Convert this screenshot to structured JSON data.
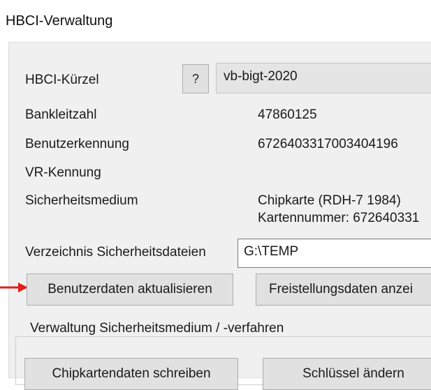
{
  "window": {
    "title": "HBCI-Verwaltung"
  },
  "hbci": {
    "kuerzel_label": "HBCI-Kürzel",
    "help_label": "?",
    "kuerzel_value": "vb-bigt-2020"
  },
  "details": {
    "blz_label": "Bankleitzahl",
    "blz_value": "47860125",
    "benutzer_label": "Benutzerkennung",
    "benutzer_value": "6726403317003404196",
    "vr_label": "VR-Kennung",
    "medium_label": "Sicherheitsmedium",
    "medium_value_line1": "Chipkarte  (RDH-7  1984)",
    "medium_value_line2": "Kartennummer: 672640331"
  },
  "directory": {
    "label": "Verzeichnis Sicherheitsdateien",
    "value": "G:\\TEMP"
  },
  "buttons": {
    "update_user": "Benutzerdaten aktualisieren",
    "show_free": "Freistellungsdaten anzei",
    "write_chip": "Chipkartendaten schreiben",
    "change_key": "Schlüssel ändern"
  },
  "group": {
    "title": "Verwaltung Sicherheitsmedium / -verfahren"
  },
  "colors": {
    "arrow": "#e0201b",
    "panel_bg": "#f0f0f0",
    "button_bg": "#e1e1e1"
  }
}
